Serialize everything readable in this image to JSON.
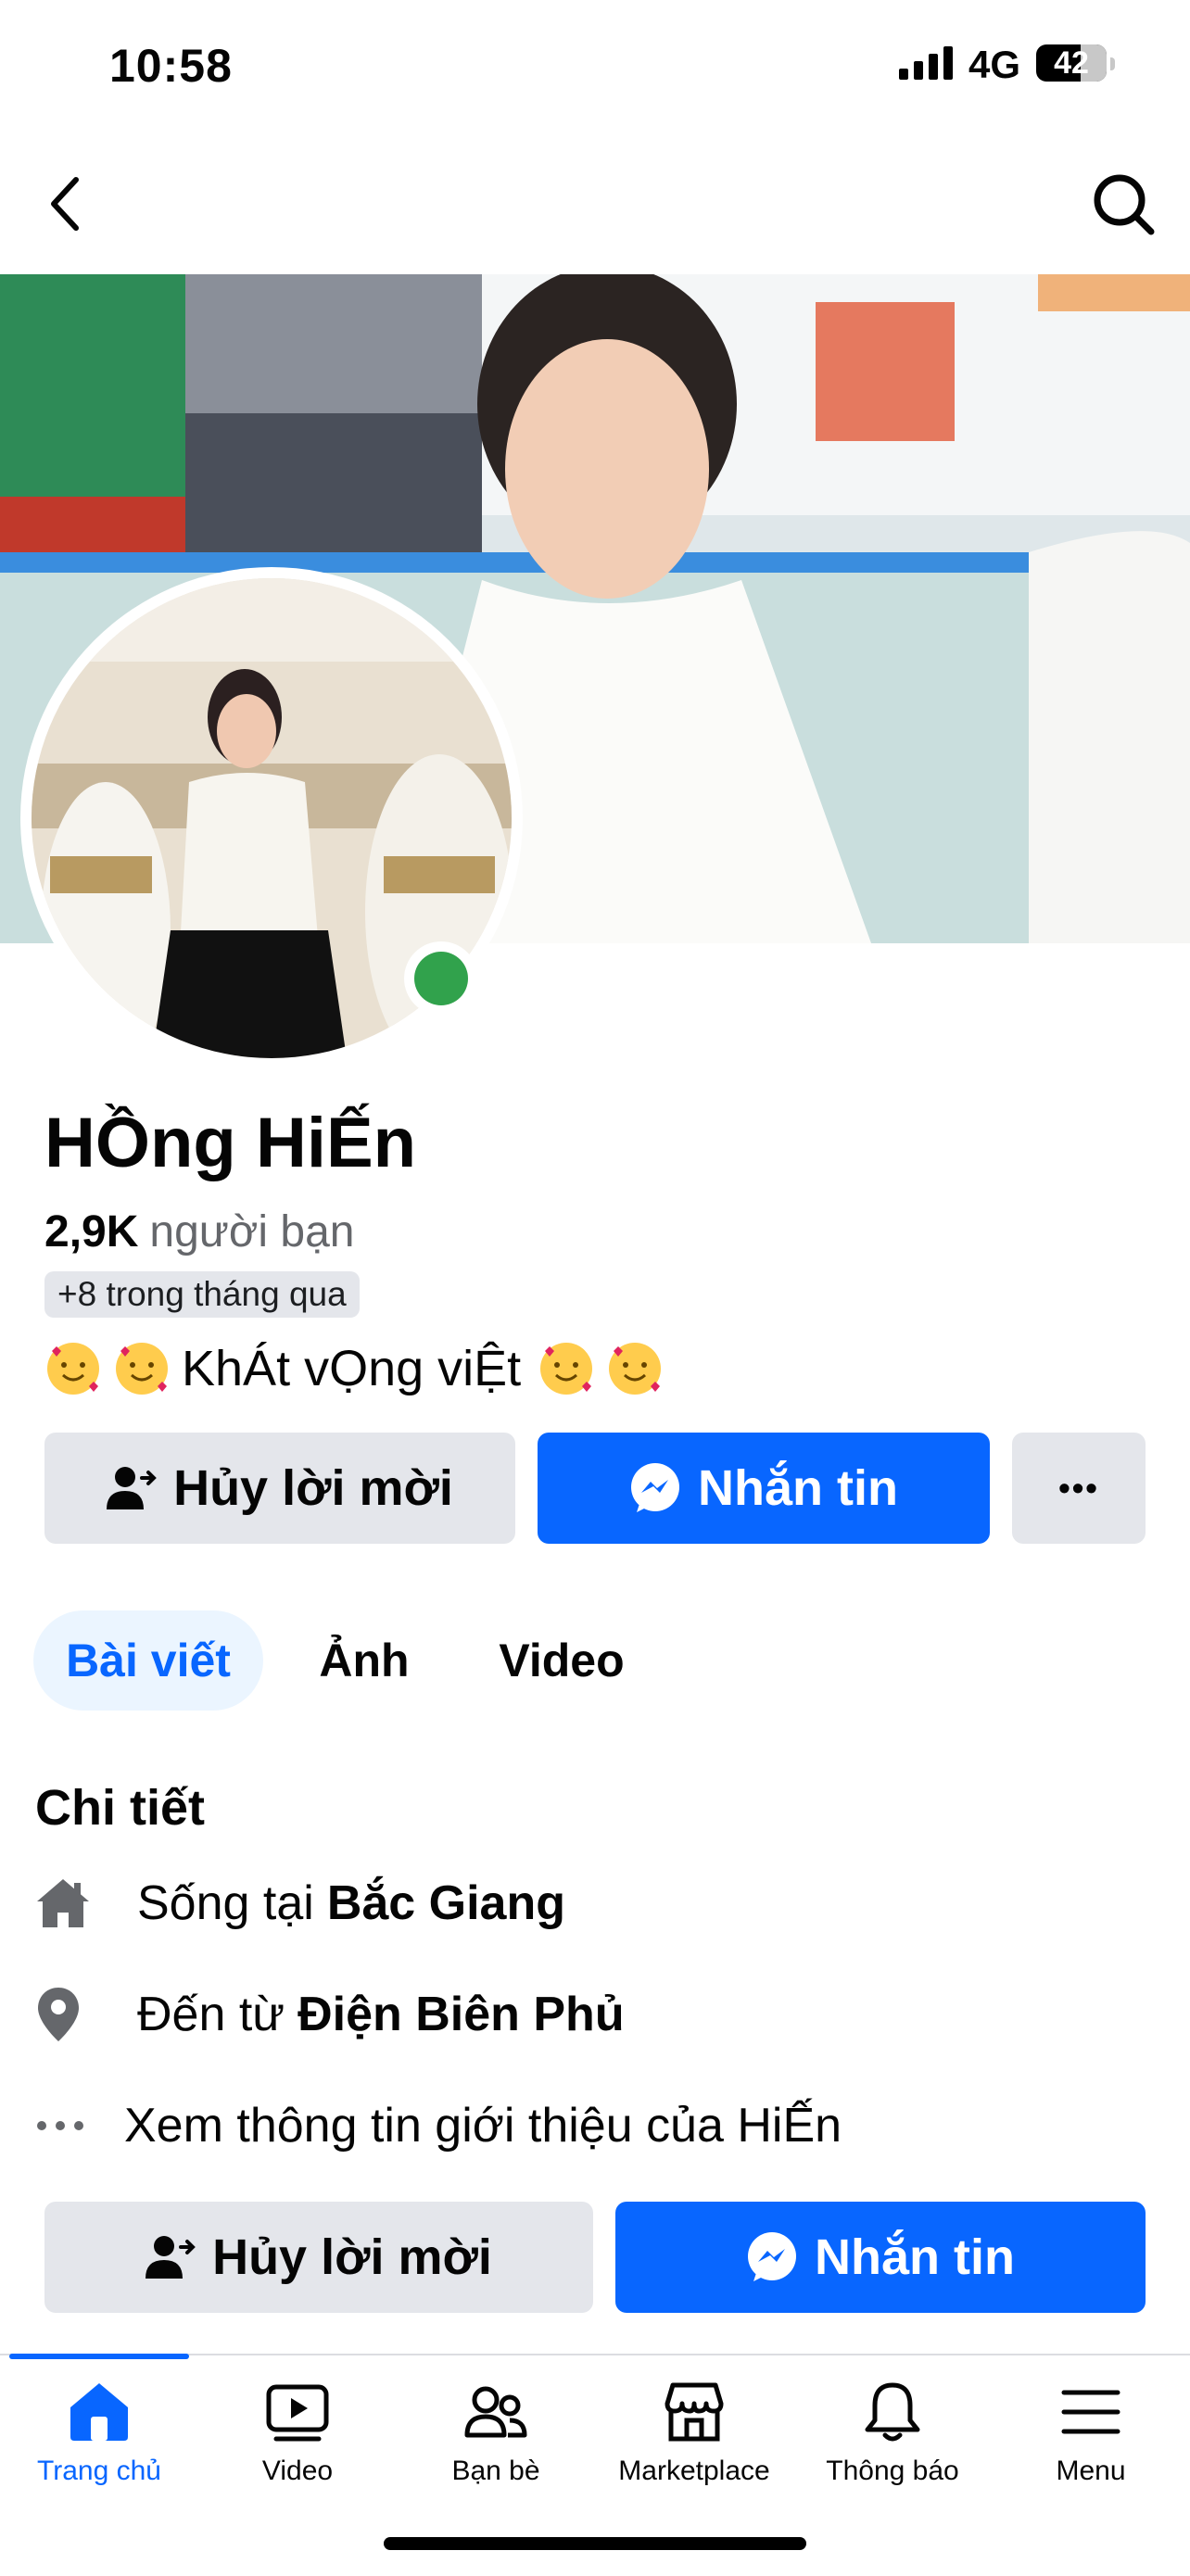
{
  "status_bar": {
    "time": "10:58",
    "network": "4G",
    "battery": "42"
  },
  "nav": {
    "back_icon": "chevron-left-icon",
    "search_icon": "search-icon"
  },
  "profile": {
    "name": "HỒng HiẾn",
    "friends_count": "2,9K",
    "friends_label": "người bạn",
    "friends_recent": "+8 trong tháng qua",
    "bio_text": "KhÁt vỌng viỆt"
  },
  "actions": {
    "cancel_request": "Hủy lời mời",
    "message": "Nhắn tin",
    "more": "•••"
  },
  "tabs": [
    {
      "label": "Bài viết",
      "active": true
    },
    {
      "label": "Ảnh",
      "active": false
    },
    {
      "label": "Video",
      "active": false
    }
  ],
  "details": {
    "title": "Chi tiết",
    "lives_prefix": "Sống tại",
    "lives_place": "Bắc Giang",
    "from_prefix": "Đến từ",
    "from_place": "Điện Biên Phủ",
    "see_about": "Xem thông tin giới thiệu của HiẾn"
  },
  "bottom_actions": {
    "cancel_request": "Hủy lời mời",
    "message": "Nhắn tin"
  },
  "bottom_nav": [
    {
      "label": "Trang chủ",
      "icon": "home-icon",
      "active": true
    },
    {
      "label": "Video",
      "icon": "video-icon",
      "active": false
    },
    {
      "label": "Bạn bè",
      "icon": "friends-icon",
      "active": false
    },
    {
      "label": "Marketplace",
      "icon": "marketplace-icon",
      "active": false
    },
    {
      "label": "Thông báo",
      "icon": "bell-icon",
      "active": false
    },
    {
      "label": "Menu",
      "icon": "menu-icon",
      "active": false
    }
  ],
  "colors": {
    "accent": "#0866ff",
    "gray_button": "#e4e6eb",
    "online": "#31a24c"
  }
}
